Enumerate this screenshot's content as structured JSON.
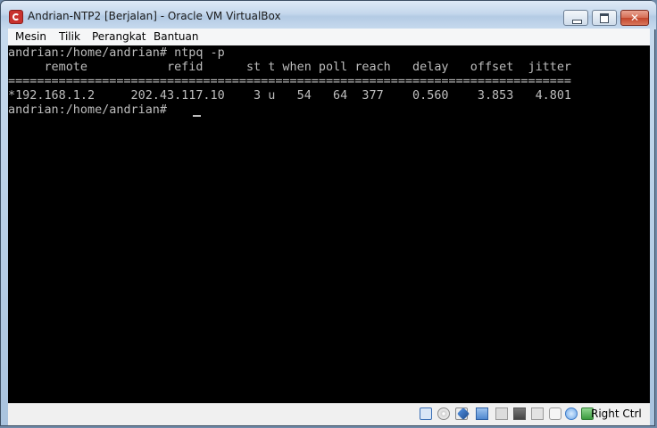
{
  "window": {
    "title": "Andrian-NTP2 [Berjalan] - Oracle VM VirtualBox"
  },
  "menu": {
    "items": [
      "Mesin",
      "Tilik",
      "Perangkat",
      "Bantuan"
    ]
  },
  "terminal": {
    "lines": [
      "andrian:/home/andrian# ntpq -p",
      "     remote           refid      st t when poll reach   delay   offset  jitter",
      "==============================================================================",
      "*192.168.1.2     202.43.117.10    3 u   54   64  377    0.560    3.853   4.801",
      "andrian:/home/andrian# "
    ]
  },
  "statusbar": {
    "icons": [
      "hard-disk-icon",
      "optical-drive-icon",
      "usb-icon",
      "network-icon",
      "shared-folders-icon",
      "display-icon",
      "video-capture-icon",
      "mouse-integration-icon",
      "host-key-arrow-icon"
    ],
    "host_key": "Right Ctrl"
  },
  "colors": {
    "terminal_bg": "#000000",
    "terminal_fg": "#bdbdbd",
    "titlebar": "#c4d7ec",
    "close_button": "#c2452b"
  }
}
